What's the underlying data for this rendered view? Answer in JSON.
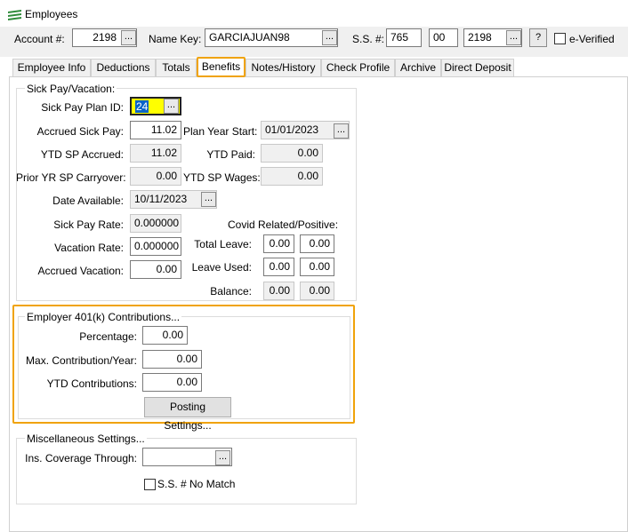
{
  "window": {
    "title": "Employees"
  },
  "header": {
    "account_label": "Account #:",
    "account_value": "2198",
    "name_key_label": "Name Key:",
    "name_key_value": "GARCIAJUAN98",
    "ss_label": "S.S. #:",
    "ss_part1": "765",
    "ss_part2": "00",
    "ss_part3": "2198",
    "help_label": "?",
    "everified_label": "e-Verified",
    "dots": "..."
  },
  "tabs": [
    {
      "label": "Employee Info"
    },
    {
      "label": "Deductions"
    },
    {
      "label": "Totals"
    },
    {
      "label": "Benefits"
    },
    {
      "label": "Notes/History"
    },
    {
      "label": "Check Profile"
    },
    {
      "label": "Archive"
    },
    {
      "label": "Direct Deposit"
    }
  ],
  "active_tab": "Benefits",
  "sick_pay": {
    "group_title": "Sick Pay/Vacation:",
    "plan_id_label": "Sick Pay Plan ID:",
    "plan_id_value": "24",
    "accrued_sick_label": "Accrued Sick Pay:",
    "accrued_sick_value": "11.02",
    "plan_year_start_label": "Plan Year Start:",
    "plan_year_start_value": "01/01/2023",
    "ytd_accrued_label": "YTD SP Accrued:",
    "ytd_accrued_value": "11.02",
    "ytd_paid_label": "YTD Paid:",
    "ytd_paid_value": "0.00",
    "prior_carryover_label": "Prior YR SP Carryover:",
    "prior_carryover_value": "0.00",
    "ytd_wages_label": "YTD SP Wages:",
    "ytd_wages_value": "0.00",
    "date_available_label": "Date Available:",
    "date_available_value": "10/11/2023",
    "sick_rate_label": "Sick Pay Rate:",
    "sick_rate_value": "0.000000",
    "vacation_rate_label": "Vacation Rate:",
    "vacation_rate_value": "0.000000",
    "accrued_vacation_label": "Accrued Vacation:",
    "accrued_vacation_value": "0.00",
    "covid_label": "Covid Related/Positive:",
    "total_leave_label": "Total Leave:",
    "total_leave_1": "0.00",
    "total_leave_2": "0.00",
    "leave_used_label": "Leave Used:",
    "leave_used_1": "0.00",
    "leave_used_2": "0.00",
    "balance_label": "Balance:",
    "balance_1": "0.00",
    "balance_2": "0.00"
  },
  "employer_401k": {
    "group_title": "Employer 401(k) Contributions...",
    "percentage_label": "Percentage:",
    "percentage_value": "0.00",
    "max_label": "Max. Contribution/Year:",
    "max_value": "0.00",
    "ytd_label": "YTD Contributions:",
    "ytd_value": "0.00",
    "posting_button": "Posting Settings..."
  },
  "misc": {
    "group_title": "Miscellaneous Settings...",
    "ins_label": "Ins. Coverage Through:",
    "ins_value": "",
    "ss_no_match_label": "S.S. # No Match"
  },
  "colors": {
    "highlight": "#f0a30a",
    "selected_field": "#ffff00",
    "selection": "#0a64c8"
  }
}
